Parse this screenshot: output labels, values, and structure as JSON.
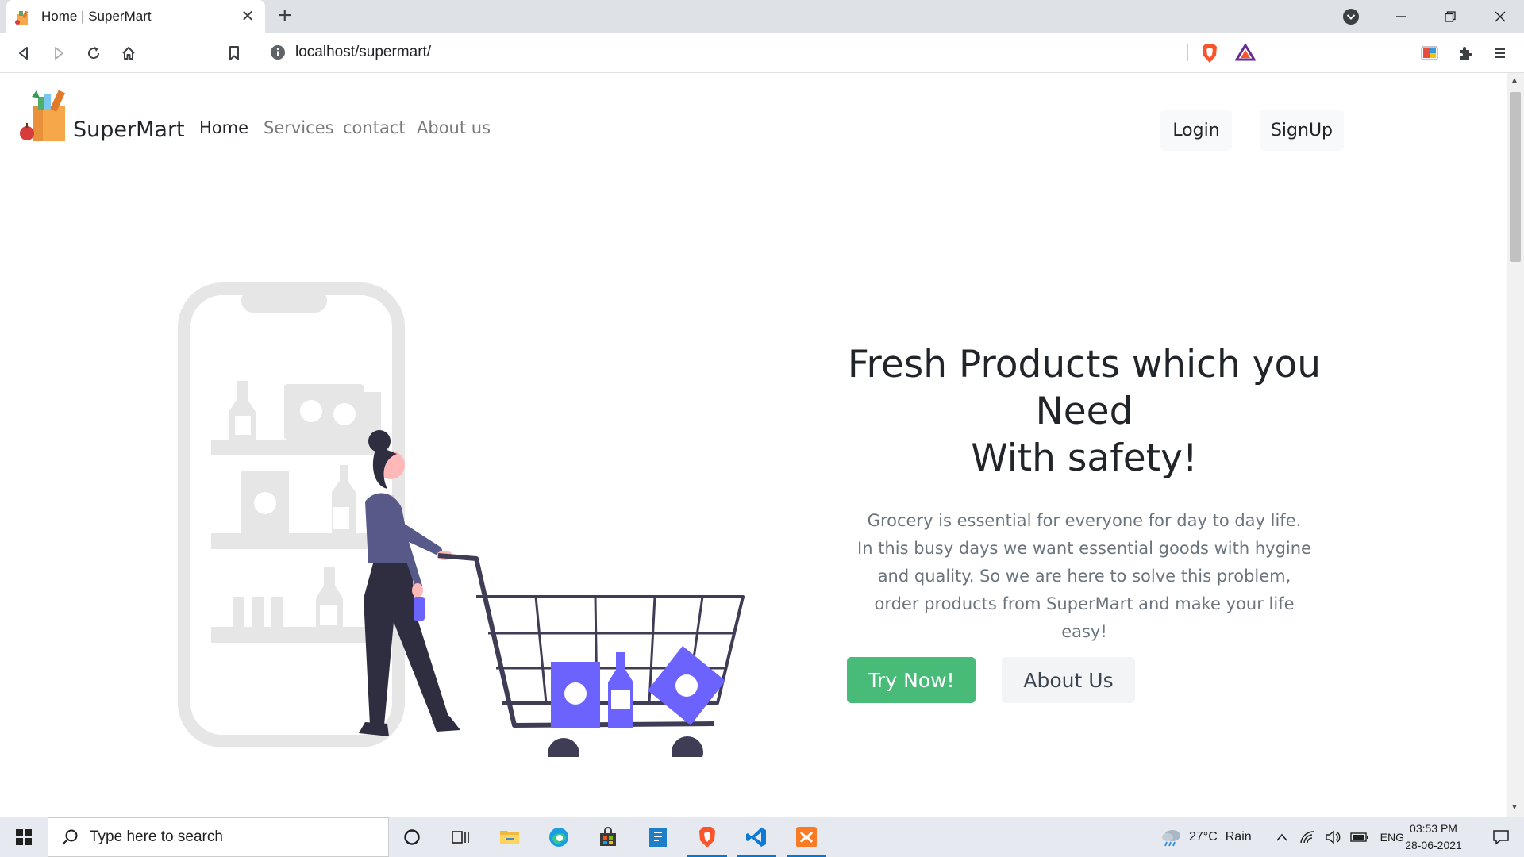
{
  "browser": {
    "tab_title": "Home | SuperMart",
    "new_tab_symbol": "+",
    "tab_close_symbol": "✕",
    "url": "localhost/supermart/"
  },
  "navbar": {
    "brand": "SuperMart",
    "links": [
      {
        "label": "Home",
        "active": true
      },
      {
        "label": "Services",
        "active": false
      },
      {
        "label": "contact",
        "active": false
      },
      {
        "label": "About us",
        "active": false
      }
    ],
    "login_label": "Login",
    "signup_label": "SignUp"
  },
  "hero": {
    "title_line1": "Fresh Products which you",
    "title_line2": "Need",
    "title_line3": "With safety!",
    "description": "Grocery is essential for everyone for day to day life. In this busy days we want essential goods with hygine and quality. So we are here to solve this problem, order products from SuperMart and make your life easy!",
    "primary_button": "Try Now!",
    "secondary_button": "About Us",
    "colors": {
      "primary": "#48bb78",
      "accent": "#6c63ff"
    }
  },
  "taskbar": {
    "search_placeholder": "Type here to search",
    "weather_temp": "27°C",
    "weather_text": "Rain",
    "language": "ENG",
    "time": "03:53 PM",
    "date": "28-06-2021",
    "apps": [
      "cortana-icon",
      "task-view-icon",
      "file-explorer-icon",
      "edge-icon",
      "store-icon",
      "app-icon",
      "brave-icon",
      "vscode-icon",
      "xampp-icon"
    ]
  }
}
